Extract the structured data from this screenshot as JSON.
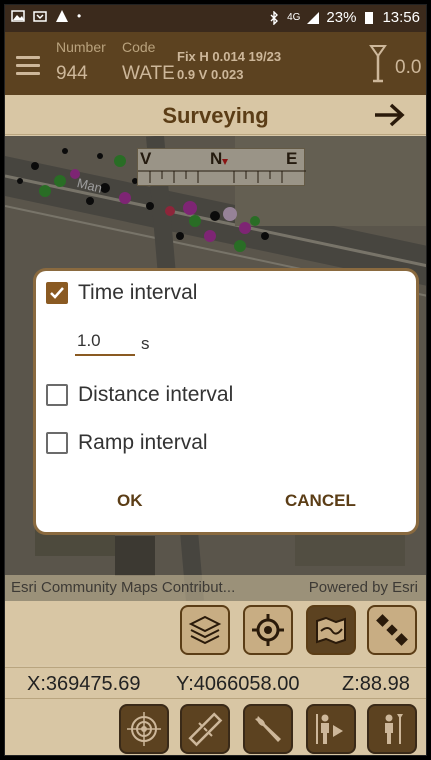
{
  "status_bar": {
    "battery": "23%",
    "time": "13:56",
    "network": "4G"
  },
  "header": {
    "number_caption": "Number",
    "number_value": "944",
    "code_caption": "Code",
    "code_value": "WATEF",
    "fix_line1": "Fix H 0.014  19/23",
    "fix_line2": "0.9 V 0.023",
    "antenna_value": "0.0"
  },
  "title_bar": {
    "title": "Surveying"
  },
  "map": {
    "compass_labels": [
      "V",
      "N",
      "E"
    ],
    "street_label": "Man",
    "attribution": "Esri Community Maps Contribut...",
    "powered_by": "Powered by Esri"
  },
  "dialog": {
    "time_interval_label": "Time interval",
    "time_interval_checked": true,
    "time_interval_value": "1.0",
    "time_unit": "s",
    "distance_interval_label": "Distance interval",
    "distance_interval_checked": false,
    "ramp_interval_label": "Ramp interval",
    "ramp_interval_checked": false,
    "ok_label": "OK",
    "cancel_label": "CANCEL"
  },
  "coordinates": {
    "x": "X:369475.69",
    "y": "Y:4066058.00",
    "z": "Z:88.98"
  },
  "colors": {
    "brand_dark": "#5c4220",
    "brand_light": "#d8c6a4",
    "accent": "#8a5a22"
  }
}
